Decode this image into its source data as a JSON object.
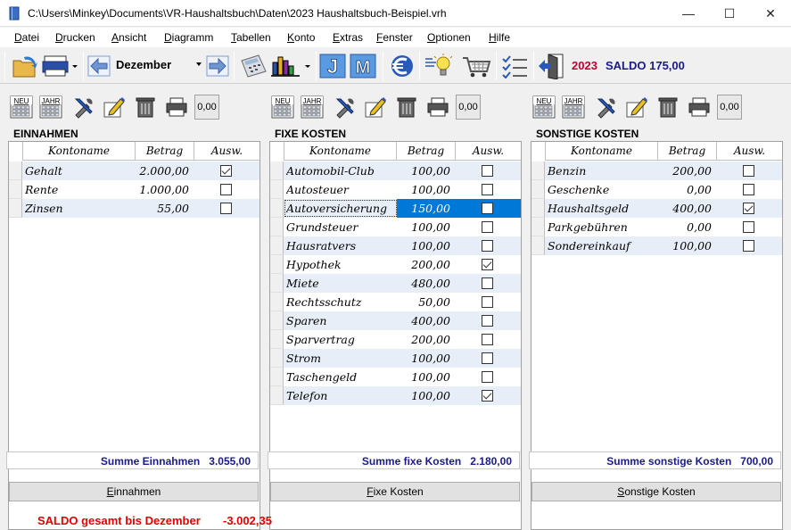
{
  "window": {
    "title": "C:\\Users\\Minkey\\Documents\\VR-Haushaltsbuch\\Daten\\2023 Haushaltsbuch-Beispiel.vrh",
    "minimize": "—",
    "maximize": "☐",
    "close": "✕"
  },
  "menu": [
    "Datei",
    "Drucken",
    "Ansicht",
    "Diagramm",
    "Tabellen",
    "Konto",
    "Extras",
    "Fenster",
    "Optionen",
    "Hilfe"
  ],
  "toolbar": {
    "month": "Dezember",
    "year": "2023",
    "saldo": "SALDO 175,00",
    "j_label": "J",
    "m_label": "M"
  },
  "panel_tools": {
    "neu": "NEU",
    "jahr": "JAHR",
    "zero": "0,00"
  },
  "columns": {
    "name": "Kontoname",
    "amount": "Betrag",
    "select": "Ausw."
  },
  "einnahmen": {
    "title": "EINNAHMEN",
    "rows": [
      {
        "name": "Gehalt",
        "amount": "2.000,00",
        "checked": true
      },
      {
        "name": "Rente",
        "amount": "1.000,00",
        "checked": false
      },
      {
        "name": "Zinsen",
        "amount": "55,00",
        "checked": false
      }
    ],
    "sum_label": "Summe Einnahmen",
    "sum_value": "3.055,00",
    "button": "Einnahmen"
  },
  "fixe": {
    "title": "FIXE KOSTEN",
    "rows": [
      {
        "name": "Automobil-Club",
        "amount": "100,00",
        "checked": false
      },
      {
        "name": "Autosteuer",
        "amount": "100,00",
        "checked": false
      },
      {
        "name": "Autoversicherung",
        "amount": "150,00",
        "checked": false,
        "selected": true
      },
      {
        "name": "Grundsteuer",
        "amount": "100,00",
        "checked": false
      },
      {
        "name": "Hausratvers",
        "amount": "100,00",
        "checked": false
      },
      {
        "name": "Hypothek",
        "amount": "200,00",
        "checked": true
      },
      {
        "name": "Miete",
        "amount": "480,00",
        "checked": false
      },
      {
        "name": "Rechtsschutz",
        "amount": "50,00",
        "checked": false
      },
      {
        "name": "Sparen",
        "amount": "400,00",
        "checked": false
      },
      {
        "name": "Sparvertrag",
        "amount": "200,00",
        "checked": false
      },
      {
        "name": "Strom",
        "amount": "100,00",
        "checked": false
      },
      {
        "name": "Taschengeld",
        "amount": "100,00",
        "checked": false
      },
      {
        "name": "Telefon",
        "amount": "100,00",
        "checked": true
      }
    ],
    "sum_label": "Summe fixe Kosten",
    "sum_value": "2.180,00",
    "button": "Fixe Kosten"
  },
  "sonstige": {
    "title": "SONSTIGE KOSTEN",
    "rows": [
      {
        "name": "Benzin",
        "amount": "200,00",
        "checked": false
      },
      {
        "name": "Geschenke",
        "amount": "0,00",
        "checked": false
      },
      {
        "name": "Haushaltsgeld",
        "amount": "400,00",
        "checked": true
      },
      {
        "name": "Parkgebühren",
        "amount": "0,00",
        "checked": false
      },
      {
        "name": "Sondereinkauf",
        "amount": "100,00",
        "checked": false
      }
    ],
    "sum_label": "Summe sonstige Kosten",
    "sum_value": "700,00",
    "button": "Sonstige Kosten"
  },
  "status": {
    "saldo_label": "SALDO gesamt bis Dezember",
    "saldo_value": "-3.002,35"
  }
}
